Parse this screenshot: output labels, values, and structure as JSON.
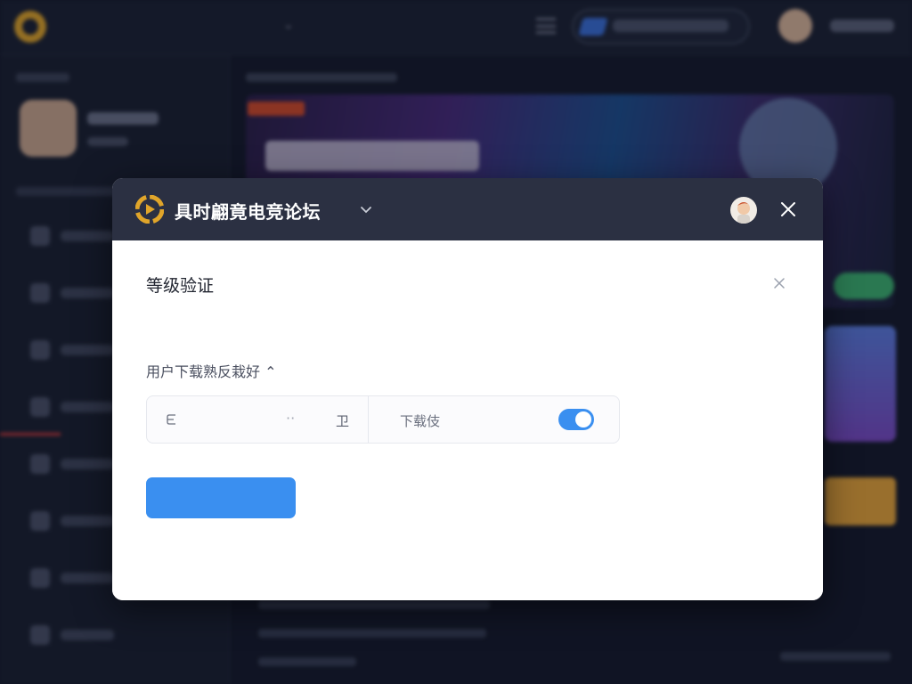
{
  "app": {
    "site_title": "",
    "dropdown_caret": "⌄"
  },
  "modal": {
    "header": {
      "title": "具时翩竟电竞论坛",
      "logo_color": "#e0a52a"
    },
    "dialog_title": "等级验证",
    "description": "",
    "subtext": "用户下载熟反栽好 ⌃",
    "option": {
      "left_text": "",
      "meta": "··",
      "tail": "卫",
      "right_label": "下载伎",
      "toggle_on": true
    },
    "primary_button": ""
  },
  "colors": {
    "accent": "#3a8ff0",
    "header_bg": "#2b3042",
    "logo_gold": "#e0a52a"
  }
}
